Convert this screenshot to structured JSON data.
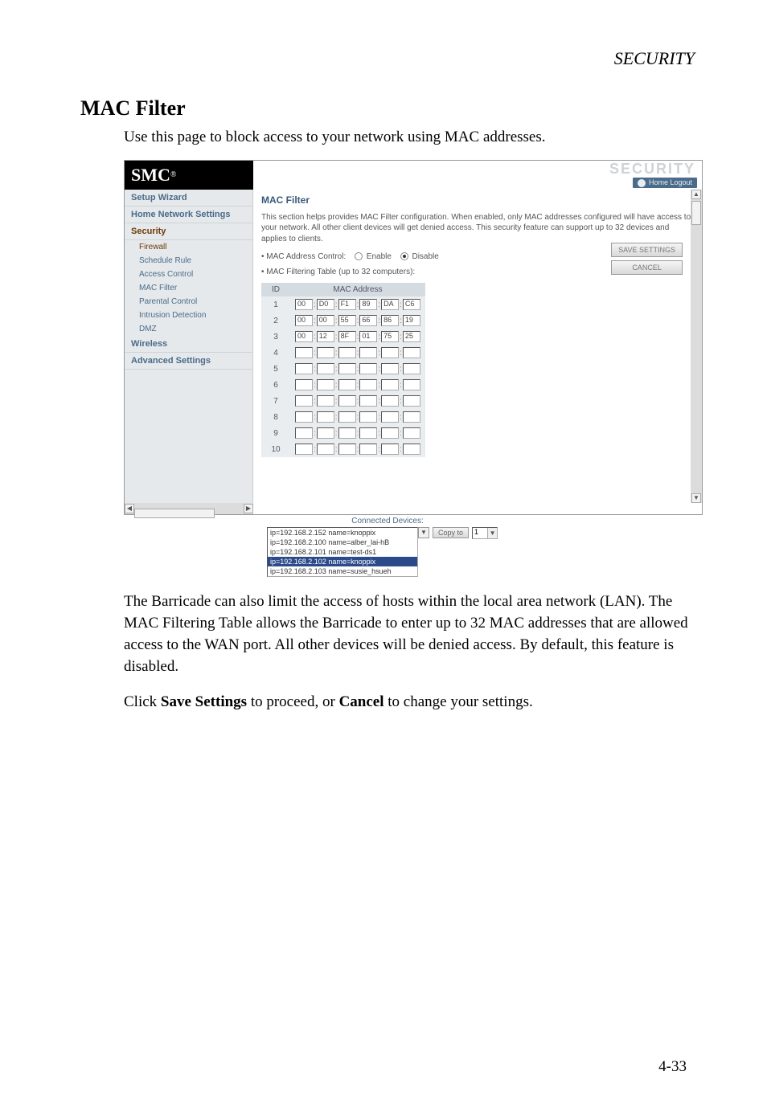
{
  "header": "SECURITY",
  "section_title": "MAC Filter",
  "intro": "Use this page to block access to your network using MAC addresses.",
  "logo": "SMC",
  "top_right_label": "SECURITY",
  "home_logout": "Home  Logout",
  "sidebar": {
    "items": [
      {
        "label": "Setup Wizard",
        "type": "top"
      },
      {
        "label": "Home Network Settings",
        "type": "top"
      },
      {
        "label": "Security",
        "type": "top",
        "active": true
      },
      {
        "label": "Firewall",
        "type": "sub",
        "active": true
      },
      {
        "label": "Schedule Rule",
        "type": "sub"
      },
      {
        "label": "Access Control",
        "type": "sub"
      },
      {
        "label": "MAC Filter",
        "type": "sub"
      },
      {
        "label": "Parental Control",
        "type": "sub"
      },
      {
        "label": "Intrusion Detection",
        "type": "sub"
      },
      {
        "label": "DMZ",
        "type": "sub"
      },
      {
        "label": "Wireless",
        "type": "top"
      },
      {
        "label": "Advanced Settings",
        "type": "top"
      }
    ]
  },
  "main": {
    "title": "MAC Filter",
    "desc": "This section helps provides MAC Filter configuration. When enabled, only MAC addresses configured will have access to your network. All other client devices will get denied access. This security feature can support up to 32 devices and applies to clients.",
    "mac_ctrl_label": "• MAC Address Control:",
    "enable": "Enable",
    "disable": "Disable",
    "table_label": "• MAC Filtering Table (up to 32 computers):",
    "save_btn": "SAVE SETTINGS",
    "cancel_btn": "CANCEL",
    "table": {
      "col_id": "ID",
      "col_mac": "MAC Address",
      "rows": [
        {
          "id": "1",
          "mac": [
            "00",
            "D0",
            "F1",
            "89",
            "DA",
            "C6"
          ]
        },
        {
          "id": "2",
          "mac": [
            "00",
            "00",
            "55",
            "66",
            "86",
            "19"
          ]
        },
        {
          "id": "3",
          "mac": [
            "00",
            "12",
            "8F",
            "01",
            "75",
            "25"
          ]
        },
        {
          "id": "4",
          "mac": [
            "",
            "",
            "",
            "",
            "",
            ""
          ]
        },
        {
          "id": "5",
          "mac": [
            "",
            "",
            "",
            "",
            "",
            ""
          ]
        },
        {
          "id": "6",
          "mac": [
            "",
            "",
            "",
            "",
            "",
            ""
          ]
        },
        {
          "id": "7",
          "mac": [
            "",
            "",
            "",
            "",
            "",
            ""
          ]
        },
        {
          "id": "8",
          "mac": [
            "",
            "",
            "",
            "",
            "",
            ""
          ]
        },
        {
          "id": "9",
          "mac": [
            "",
            "",
            "",
            "",
            "",
            ""
          ]
        },
        {
          "id": "10",
          "mac": [
            "",
            "",
            "",
            "",
            "",
            ""
          ]
        }
      ]
    }
  },
  "connected": {
    "title": "Connected Devices:",
    "items": [
      {
        "text": "ip=192.168.2.152 name=knoppix",
        "sel": false
      },
      {
        "text": "ip=192.168.2.100 name=alber_lai-hB",
        "sel": false
      },
      {
        "text": "ip=192.168.2.101 name=test-ds1",
        "sel": false
      },
      {
        "text": "ip=192.168.2.102 name=knoppix",
        "sel": true
      },
      {
        "text": "ip=192.168.2.103 name=susie_hsueh",
        "sel": false
      }
    ],
    "copy_btn": "Copy to",
    "copy_val": "1"
  },
  "para1": "The Barricade can also limit the access of hosts within the local area network (LAN). The MAC Filtering Table allows the Barricade to enter up to 32 MAC addresses that are allowed access to the WAN port. All other devices will be denied access. By default, this feature is disabled.",
  "para2_a": "Click ",
  "para2_b": "Save Settings",
  "para2_c": " to proceed, or ",
  "para2_d": "Cancel",
  "para2_e": " to change your settings.",
  "page_num": "4-33"
}
